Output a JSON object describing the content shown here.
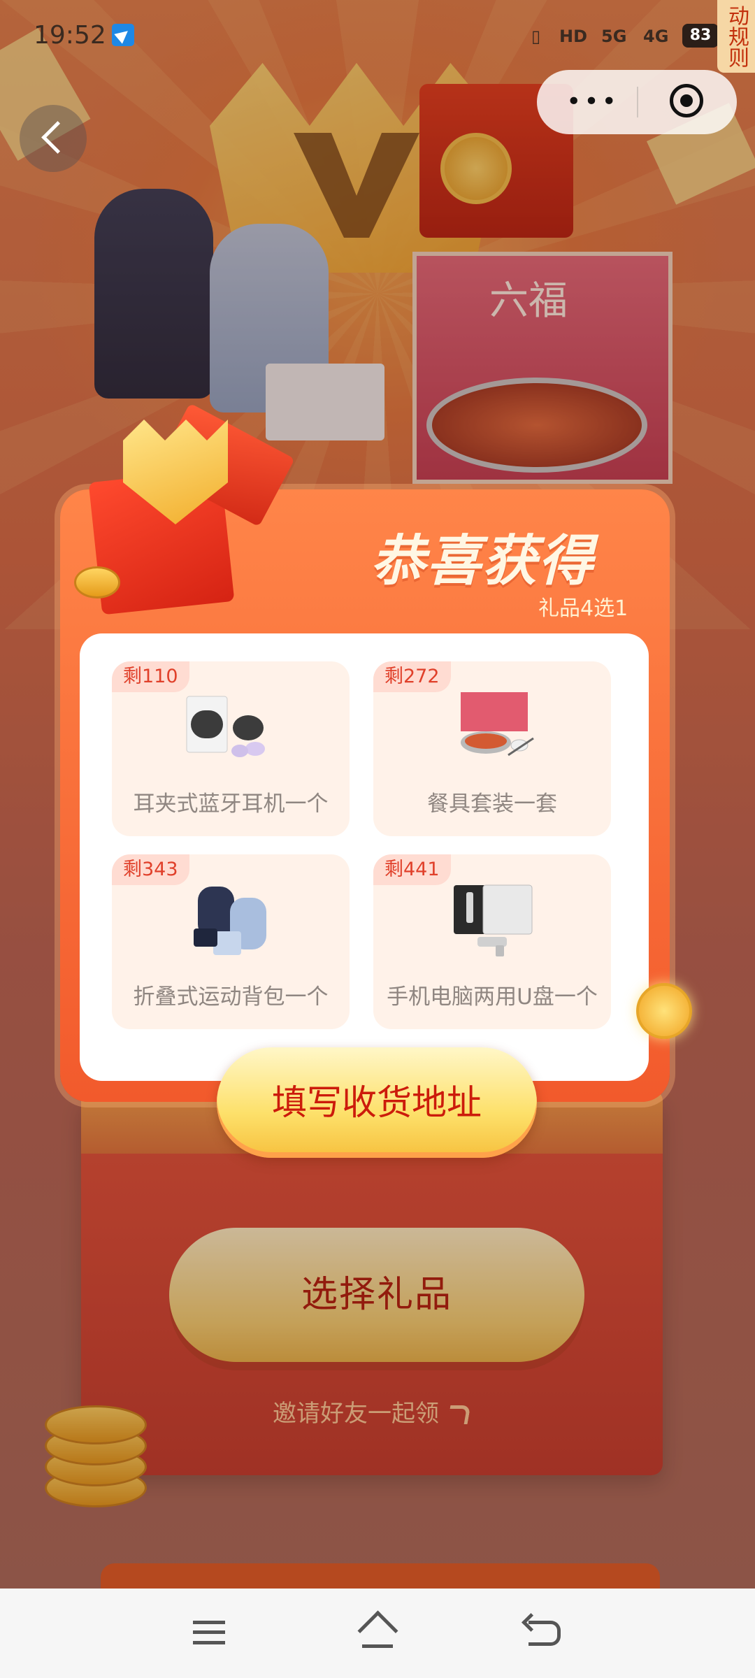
{
  "status_bar": {
    "time": "19:52",
    "network_1": "5G",
    "network_2": "4G",
    "battery": "83"
  },
  "rules_tab": "动规则",
  "capsule": {
    "more_icon": "•••",
    "close_icon": "target-icon"
  },
  "modal": {
    "title": "恭喜获得",
    "subtitle": "礼品4选1",
    "prizes": [
      {
        "badge": "剩110",
        "label": "耳夹式蓝牙耳机一个",
        "icon": "earbuds-icon"
      },
      {
        "badge": "剩272",
        "label": "餐具套装一套",
        "icon": "tableware-icon"
      },
      {
        "badge": "剩343",
        "label": "折叠式运动背包一个",
        "icon": "backpack-icon"
      },
      {
        "badge": "剩441",
        "label": "手机电脑两用U盘一个",
        "icon": "usb-drive-icon"
      }
    ],
    "fill_address_button": "填写收货地址"
  },
  "background": {
    "choose_gift_button": "选择礼品",
    "invite_text": "邀请好友一起领"
  },
  "colors": {
    "accent_orange": "#f25a2c",
    "button_yellow": "#fde06a",
    "button_text_red": "#cc1b0b"
  }
}
